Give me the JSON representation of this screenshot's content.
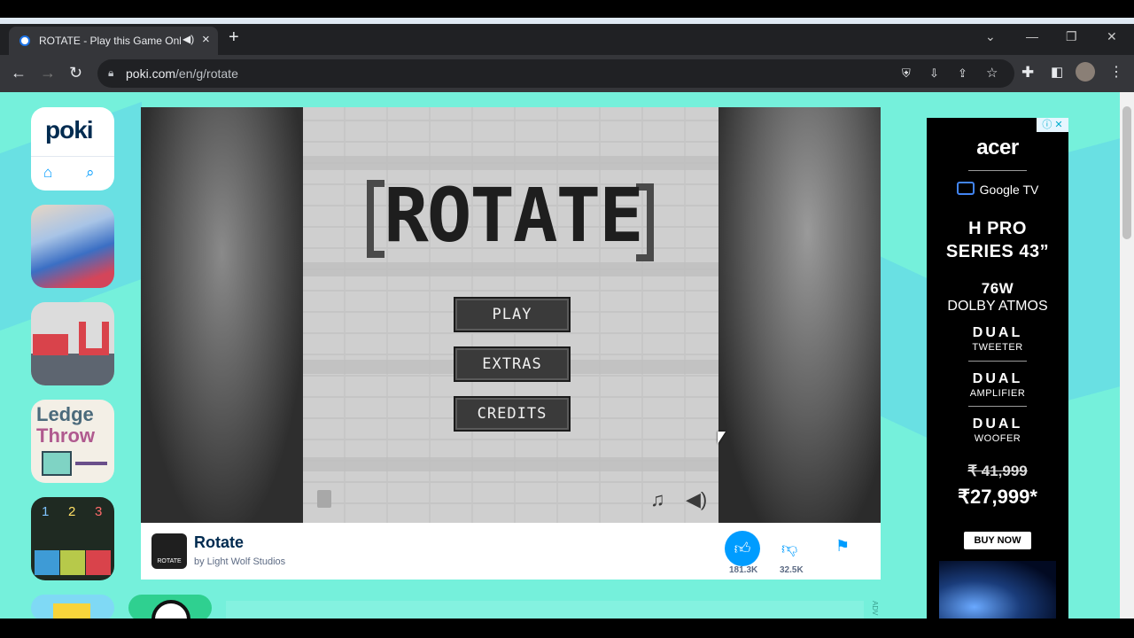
{
  "browser": {
    "tab_title": "ROTATE - Play this Game Onl",
    "audio_icon": "◀)",
    "close_icon": "×",
    "new_tab": "+",
    "url_domain": "poki.com",
    "url_path": "/en/g/rotate"
  },
  "sidebar": {
    "logo": "poki",
    "home_icon": "home-icon",
    "search_icon": "search-icon",
    "ledge_line1": "Ledge",
    "ledge_line2": "Throw",
    "numbers": [
      "1",
      "2",
      "3"
    ]
  },
  "game": {
    "title": "ROTATE",
    "menu": [
      "PLAY",
      "EXTRAS",
      "CREDITS"
    ],
    "thumb_label": "ROTATE"
  },
  "gamebar": {
    "name": "Rotate",
    "developer": "by Light Wolf Studios",
    "likes": "181.3K",
    "dislikes": "32.5K"
  },
  "ad": {
    "brand": "acer",
    "partner": "Google TV",
    "model_line1": "H PRO",
    "model_line2": "SERIES 43”",
    "power": "76W",
    "audio": "DOLBY ATMOS",
    "feature1_top": "DUAL",
    "feature1_bottom": "TWEETER",
    "feature2_top": "DUAL",
    "feature2_bottom": "AMPLIFIER",
    "feature3_top": "DUAL",
    "feature3_bottom": "WOOFER",
    "old_price": "₹ 41,999",
    "price": "₹27,999*",
    "cta": "BUY NOW",
    "side_label": "ADV"
  },
  "colors": {
    "page_bg": "#75f0db",
    "poki_blue": "#009cff",
    "poki_navy": "#002b50"
  }
}
